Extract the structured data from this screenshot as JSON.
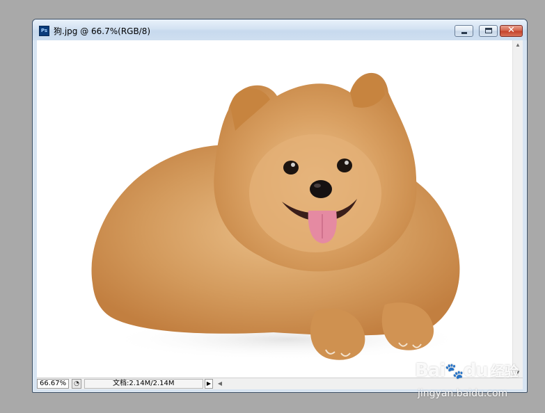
{
  "window": {
    "title": "狗.jpg @ 66.7%(RGB/8)",
    "app_icon_label": "Ps",
    "icons": {
      "app": "photoshop-icon",
      "minimize": "minimize-icon",
      "maximize": "maximize-icon",
      "close": "close-icon"
    }
  },
  "statusbar": {
    "zoom": "66.67%",
    "doc_info": "文档:2.14M/2.14M",
    "menu_arrow": "▶"
  },
  "canvas": {
    "image_subject": "pomeranian-dog",
    "colors": {
      "background": "#ffffff",
      "fur_main": "#c98a4a",
      "fur_light": "#e8bb85",
      "tongue": "#e58aa2"
    }
  },
  "watermark": {
    "logo": "Bai",
    "logo_tail": "du",
    "cn_text": "经验",
    "url": "jingyan.baidu.com"
  }
}
